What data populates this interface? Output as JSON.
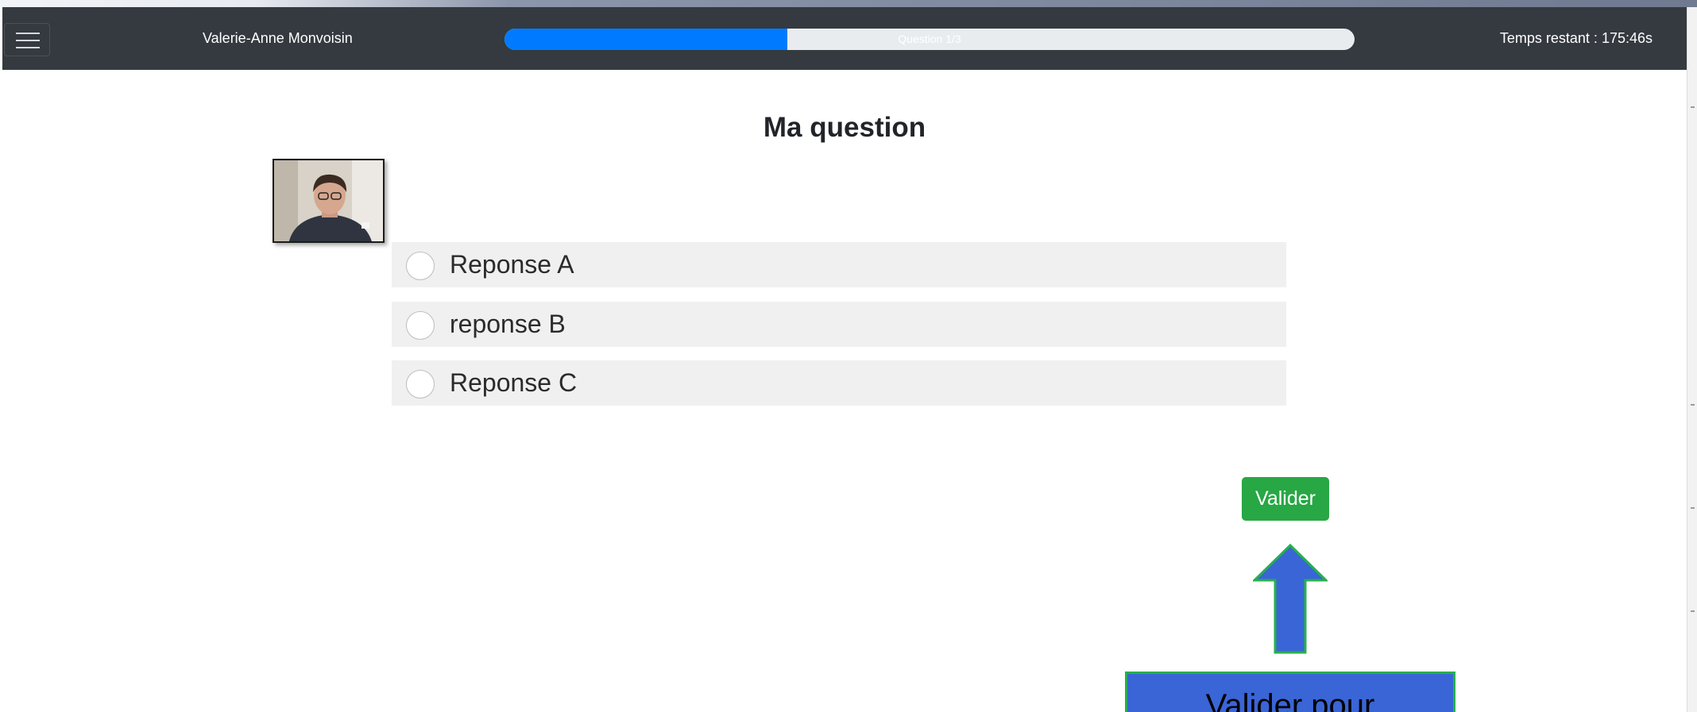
{
  "navbar": {
    "menu_icon": "hamburger-menu-icon",
    "user_name": "Valerie-Anne Monvoisin",
    "progress": {
      "label": "Question 1/3",
      "fraction": 0.333
    },
    "timer": "Temps restant : 175:46s"
  },
  "question": {
    "title": "Ma question",
    "answers": [
      {
        "label": "Reponse A",
        "selected": false
      },
      {
        "label": "reponse B",
        "selected": false
      },
      {
        "label": "Reponse C",
        "selected": false
      }
    ]
  },
  "actions": {
    "validate_label": "Valider"
  },
  "annotation": {
    "arrow_icon": "up-arrow-icon",
    "callout_text": "Valider pour",
    "fill_color": "#3a65d6",
    "border_color": "#27b04c"
  },
  "colors": {
    "navbar": "#343a40",
    "progress": "#007bff",
    "validate": "#28a745"
  }
}
